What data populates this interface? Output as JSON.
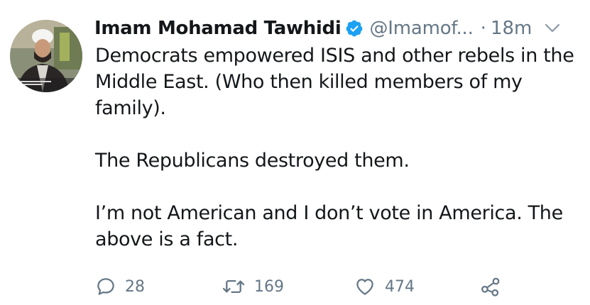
{
  "tweet": {
    "author": {
      "display_name": "Imam Mohamad Tawhidi",
      "handle": "@Imamof...",
      "verified": true
    },
    "separator": "·",
    "time": "18m",
    "text_lines": [
      "Democrats empowered ISIS and other rebels in the Middle East. (Who then killed members of my family).",
      "The Republicans destroyed them.",
      "I’m not American and I don’t vote in America. The above is a fact."
    ]
  },
  "actions": {
    "reply_count": "28",
    "retweet_count": "169",
    "like_count": "474"
  },
  "icons": {
    "verified": "verified-badge-icon",
    "menu": "chevron-down-icon",
    "reply": "reply-icon",
    "retweet": "retweet-icon",
    "like": "heart-icon",
    "share": "share-icon"
  },
  "colors": {
    "text": "#14171a",
    "muted": "#657786",
    "verified": "#1da1f2",
    "background": "#ffffff"
  }
}
